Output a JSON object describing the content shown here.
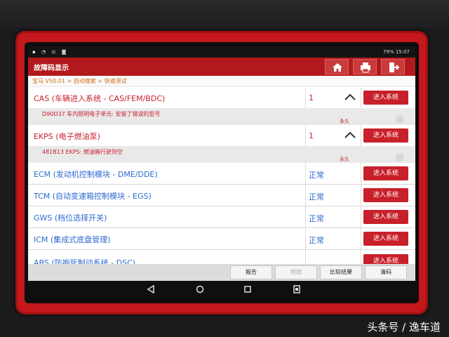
{
  "status_bar": {
    "right_text": "79% 15:07"
  },
  "title_bar": {
    "title": "故障码显示",
    "buttons": [
      "home-icon",
      "print-icon",
      "exit-icon"
    ]
  },
  "breadcrumb": "宝马 V50.01 > 自动搜索 > 快速测试",
  "rows": [
    {
      "name": "CAS (车辆进入系统 - CAS/FEM/BDC)",
      "value": "1",
      "button": "进入系统",
      "style": "fault",
      "fault_code": "D90D37 车内照明电子单元: 安装了错误的型号",
      "fault_status": "永久"
    },
    {
      "name": "EKPS (电子燃油泵)",
      "value": "1",
      "button": "进入系统",
      "style": "fault",
      "fault_code": "481B13 EKPS: 燃油箱行驶到空",
      "fault_status": "永久"
    },
    {
      "name": "ECM (发动机控制模块 - DME/DDE)",
      "value": "正常",
      "button": "进入系统",
      "style": "ok"
    },
    {
      "name": "TCM (自动变速箱控制模块 - EGS)",
      "value": "正常",
      "button": "进入系统",
      "style": "ok"
    },
    {
      "name": "GWS (档位选择开关)",
      "value": "正常",
      "button": "进入系统",
      "style": "ok"
    },
    {
      "name": "ICM (集成式底盘管理)",
      "value": "正常",
      "button": "进入系统",
      "style": "ok"
    },
    {
      "name": "ABS (防抱死制动系统 - DSC)",
      "value": "",
      "button": "进入系统",
      "style": "ok"
    }
  ],
  "bottom_buttons": [
    {
      "label": "报告",
      "enabled": true
    },
    {
      "label": "帮助",
      "enabled": false
    },
    {
      "label": "比较结果",
      "enabled": true
    },
    {
      "label": "清码",
      "enabled": true
    }
  ],
  "nav_buttons": [
    "back-icon",
    "home-circle-icon",
    "recents-icon",
    "screenshot-icon"
  ],
  "watermark": "头条号 / 逸车道",
  "colors": {
    "brand_red": "#c4181c",
    "title_red": "#b3191c",
    "button_red": "#c8202a",
    "link_blue": "#2d6ad0"
  }
}
